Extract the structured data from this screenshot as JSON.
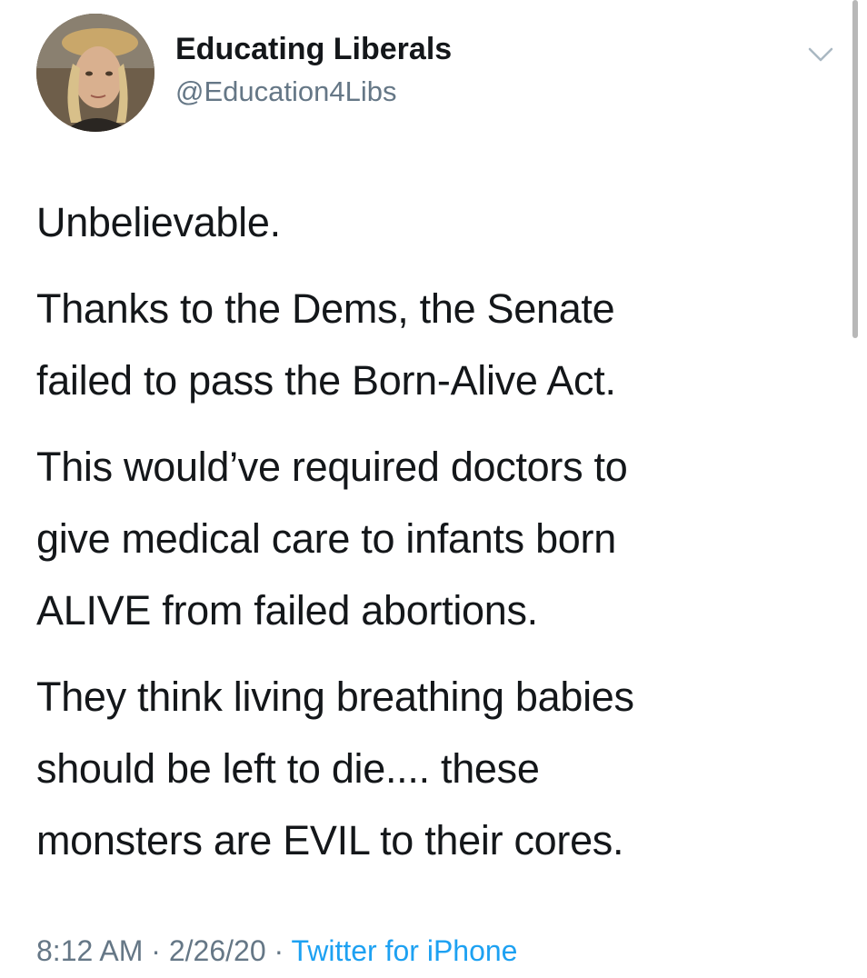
{
  "author": {
    "display_name": "Educating Liberals",
    "handle": "@Education4Libs",
    "avatar_icon": "profile-photo"
  },
  "menu_icon": "chevron-down-icon",
  "tweet": {
    "paragraphs": [
      [
        "Unbelievable."
      ],
      [
        "Thanks to the Dems, the Senate",
        "failed to pass the Born-Alive Act."
      ],
      [
        "This would’ve required doctors to",
        "give medical care to infants born",
        "ALIVE from failed abortions."
      ],
      [
        "They think living breathing babies",
        "should be left to die.... these",
        "monsters are EVIL to their cores."
      ]
    ]
  },
  "meta": {
    "time": "8:12 AM",
    "separator": " · ",
    "date": "2/26/20",
    "source": "Twitter for iPhone"
  },
  "colors": {
    "text": "#14171a",
    "secondary": "#657786",
    "link": "#1da1f2"
  }
}
